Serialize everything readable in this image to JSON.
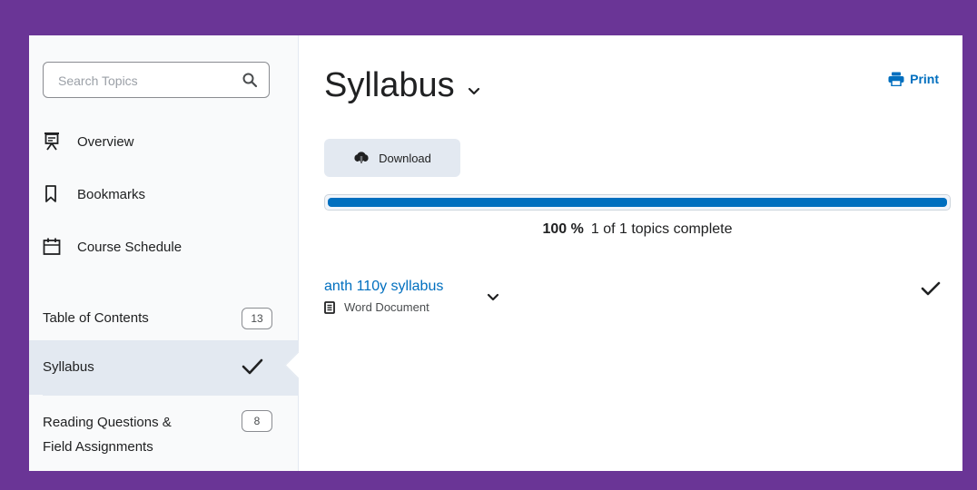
{
  "sidebar": {
    "search_placeholder": "Search Topics",
    "search_icon": "magnifier-icon",
    "nav": [
      {
        "label": "Overview",
        "icon": "presentation-board-icon"
      },
      {
        "label": "Bookmarks",
        "icon": "bookmark-icon"
      },
      {
        "label": "Course Schedule",
        "icon": "calendar-icon"
      }
    ],
    "toc": {
      "label": "Table of Contents",
      "count": "13"
    },
    "syllabus": {
      "label": "Syllabus",
      "status": "complete",
      "icon": "checkmark-icon"
    },
    "reading": {
      "label_line1": "Reading Questions &",
      "label_line2": "Field Assignments",
      "count": "8"
    }
  },
  "main": {
    "title": "Syllabus",
    "print_label": "Print",
    "download_label": "Download",
    "progress": {
      "percent_value": 100,
      "percent_text": "100 %",
      "summary": "1 of 1 topics complete"
    },
    "topic": {
      "name": "anth 110y syllabus",
      "type": "Word Document",
      "status": "complete"
    }
  },
  "colors": {
    "frame_background": "#6a3596",
    "accent": "#006fbf",
    "active_row": "#e3e9f1"
  }
}
